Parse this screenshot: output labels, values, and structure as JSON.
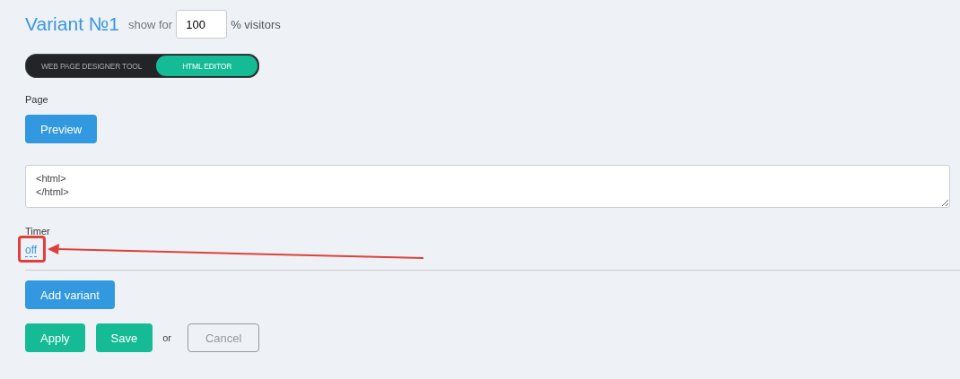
{
  "variant": {
    "title": "Variant №1",
    "show_for_label": "show for",
    "percent": "100",
    "percent_suffix": "% visitors"
  },
  "editor_toggle": [
    {
      "label": "WEB PAGE DESIGNER TOOL",
      "selected": false
    },
    {
      "label": "HTML EDITOR",
      "selected": true
    }
  ],
  "page": {
    "label": "Page",
    "preview_button": "Preview",
    "code": "<html>\n</html>"
  },
  "timer": {
    "label": "Timer",
    "value": "off"
  },
  "add_variant_button": "Add variant",
  "actions": {
    "apply": "Apply",
    "save": "Save",
    "or": "or",
    "cancel": "Cancel"
  }
}
